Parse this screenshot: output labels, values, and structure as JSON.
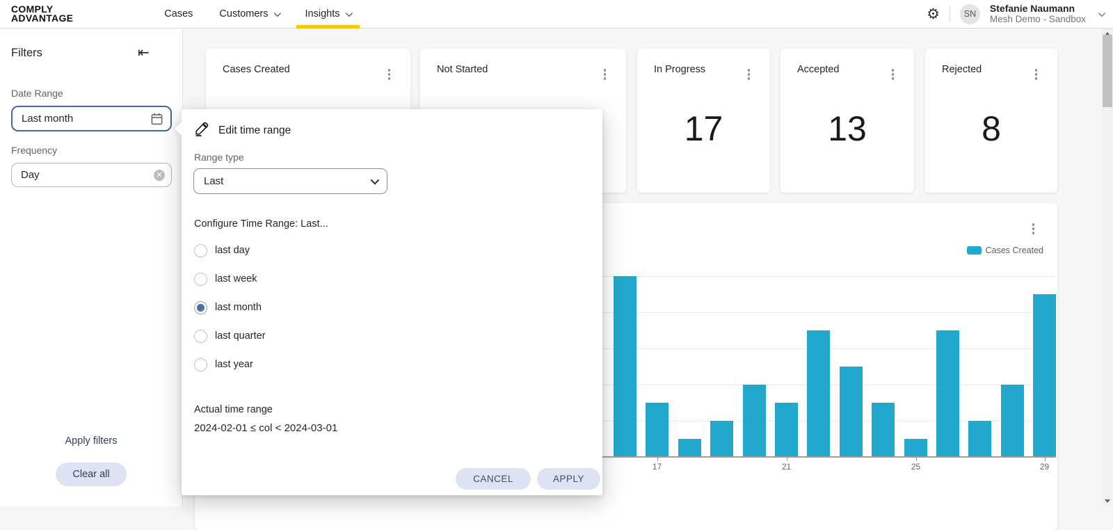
{
  "header": {
    "logo_line1": "COMPLY",
    "logo_line2": "ADVANTAGE",
    "nav": [
      {
        "label": "Cases",
        "chevron": false,
        "active": false
      },
      {
        "label": "Customers",
        "chevron": true,
        "active": false
      },
      {
        "label": "Insights",
        "chevron": true,
        "active": true
      }
    ],
    "user": {
      "initials": "SN",
      "name": "Stefanie Naumann",
      "org": "Mesh Demo - Sandbox"
    }
  },
  "sidebar": {
    "title": "Filters",
    "date_range_label": "Date Range",
    "date_range_value": "Last month",
    "frequency_label": "Frequency",
    "frequency_value": "Day",
    "apply_label": "Apply filters",
    "clear_label": "Clear all"
  },
  "kpis": [
    {
      "title": "Cases Created",
      "value": ""
    },
    {
      "title": "Not Started",
      "value": ""
    },
    {
      "title": "In Progress",
      "value": "17"
    },
    {
      "title": "Accepted",
      "value": "13"
    },
    {
      "title": "Rejected",
      "value": "8"
    }
  ],
  "time_range_popover": {
    "title": "Edit time range",
    "range_type_label": "Range type",
    "range_type_value": "Last",
    "configure_label": "Configure Time Range: Last...",
    "options": [
      {
        "label": "last day",
        "selected": false
      },
      {
        "label": "last week",
        "selected": false
      },
      {
        "label": "last month",
        "selected": true
      },
      {
        "label": "last quarter",
        "selected": false
      },
      {
        "label": "last year",
        "selected": false
      }
    ],
    "actual_label": "Actual time range",
    "actual_value": "2024-02-01 ≤ col < 2024-03-01",
    "cancel_label": "CANCEL",
    "apply_label": "APPLY"
  },
  "chart_data": {
    "type": "bar",
    "x": [
      16,
      17,
      18,
      19,
      20,
      21,
      22,
      23,
      24,
      25,
      26,
      27,
      28,
      29
    ],
    "series": [
      {
        "name": "Cases Created",
        "values": [
          10,
          3,
          1,
          2,
          4,
          3,
          7,
          5,
          3,
          1,
          7,
          2,
          4,
          9
        ]
      }
    ],
    "x_tick_labels": [
      "17",
      "21",
      "25",
      "29"
    ],
    "ylim": [
      0,
      10
    ],
    "gridline_step": 2,
    "grid": true,
    "legend": [
      {
        "label": "Cases Created",
        "color": "#22a8cc"
      }
    ],
    "legend_position": "top-right"
  },
  "colors": {
    "accent_teal": "#22a8cc",
    "nav_active_underline": "#f2c811",
    "radio_selected": "#4a6fa5",
    "date_input_border": "#40699f",
    "button_bg": "#dde3f2",
    "button_text": "#3d4e6b"
  }
}
